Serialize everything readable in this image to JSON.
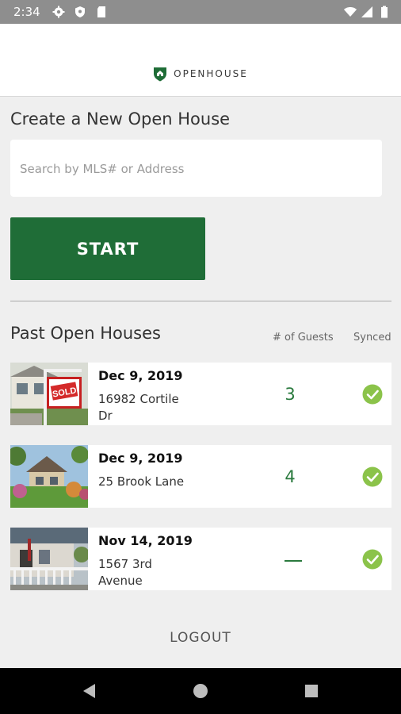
{
  "status_bar": {
    "time": "2:34"
  },
  "header": {
    "brand_name": "OPENHOUSE"
  },
  "create": {
    "title": "Create a New Open House",
    "search_placeholder": "Search by MLS# or Address",
    "start_label": "START"
  },
  "past": {
    "title": "Past Open Houses",
    "guests_header": "# of Guests",
    "synced_header": "Synced",
    "rows": [
      {
        "date": "Dec 9, 2019",
        "address": "16982 Cortile Dr",
        "guests": "3",
        "synced": true
      },
      {
        "date": "Dec 9, 2019",
        "address": "25 Brook Lane",
        "guests": "4",
        "synced": true
      },
      {
        "date": "Nov 14, 2019",
        "address": "1567 3rd Avenue",
        "guests": "",
        "synced": true
      }
    ]
  },
  "sold_sign_text": "SOLD",
  "logout_label": "LOGOUT",
  "colors": {
    "brand_green": "#1f6d37",
    "check_green": "#8bc34a",
    "guest_green": "#2a7a3e"
  },
  "icons": [
    "settings-icon",
    "shield-icon",
    "sd-card-icon",
    "wifi-icon",
    "signal-icon",
    "battery-icon",
    "back-icon",
    "home-icon",
    "recents-icon",
    "check-circle-icon"
  ]
}
